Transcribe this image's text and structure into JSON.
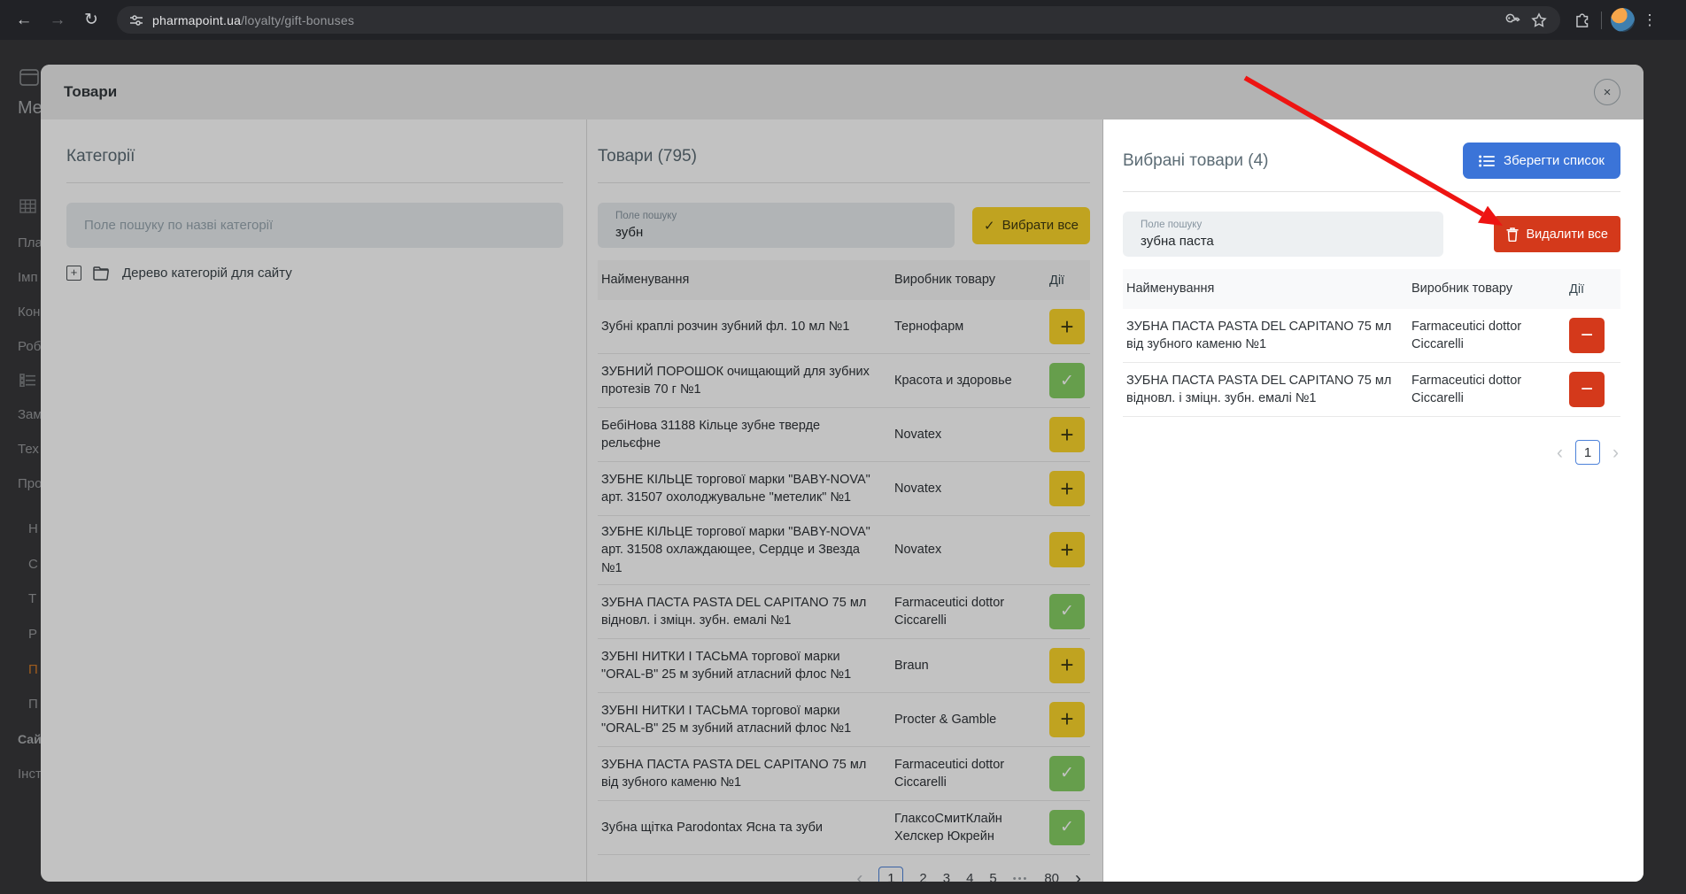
{
  "browser": {
    "url_domain": "pharmapoint.ua",
    "url_path": "/loyalty/gift-bonuses"
  },
  "sidebar": {
    "items": [
      {
        "label": "Me"
      },
      {
        "label": "Пла"
      },
      {
        "label": "Імп"
      },
      {
        "label": "Кон"
      },
      {
        "label": "Роб"
      },
      {
        "label": "Зам"
      },
      {
        "label": "Тех"
      },
      {
        "label": "Про"
      },
      {
        "label": "Н"
      },
      {
        "label": "С"
      },
      {
        "label": "Т"
      },
      {
        "label": "Р"
      },
      {
        "label": "П"
      },
      {
        "label": "П"
      },
      {
        "label": "Сай"
      },
      {
        "label": "Інст"
      }
    ]
  },
  "modal": {
    "title": "Товари"
  },
  "categories": {
    "title": "Категорії",
    "search_placeholder": "Поле пошуку по назві категорії",
    "tree_link": "Дерево категорій для сайту"
  },
  "products": {
    "title": "Товари (795)",
    "search_label": "Поле пошуку",
    "search_value": "зубн",
    "select_all_label": "Вибрати все",
    "columns": {
      "name": "Найменування",
      "manufacturer": "Виробник товару",
      "actions": "Дії"
    },
    "rows": [
      {
        "name": "Зубні краплі розчин зубний фл. 10 мл №1",
        "manufacturer": "Тернофарм",
        "state": "available"
      },
      {
        "name": "ЗУБНИЙ ПОРОШОК очищающий для зубних протезів 70 г №1",
        "manufacturer": "Красота и здоровье",
        "state": "added"
      },
      {
        "name": "БебіНова 31188 Кільце зубне тверде рельєфне",
        "manufacturer": "Novatex",
        "state": "available"
      },
      {
        "name": "ЗУБНЕ КІЛЬЦЕ торгової марки \"BABY-NOVA\" арт. 31507 охолоджувальне \"метелик\" №1",
        "manufacturer": "Novatex",
        "state": "available"
      },
      {
        "name": "ЗУБНЕ КІЛЬЦЕ торгової марки \"BABY-NOVA\" арт. 31508 охлаждающее, Сердце и Звезда №1",
        "manufacturer": "Novatex",
        "state": "available"
      },
      {
        "name": "ЗУБНА ПАСТА PASTA DEL CAPITANO 75 мл відновл. і зміцн. зубн. емалі №1",
        "manufacturer": "Farmaceutici dottor Ciccarelli",
        "state": "added"
      },
      {
        "name": "ЗУБНІ НИТКИ І ТАСЬМА торгової марки \"ORAL-B\" 25 м зубний атласний флос №1",
        "manufacturer": "Braun",
        "state": "available"
      },
      {
        "name": "ЗУБНІ НИТКИ І ТАСЬМА торгової марки \"ORAL-B\" 25 м зубний атласний флос №1",
        "manufacturer": "Procter & Gamble",
        "state": "available"
      },
      {
        "name": "ЗУБНА ПАСТА PASTA DEL CAPITANO 75 мл від зубного каменю №1",
        "manufacturer": "Farmaceutici dottor Ciccarelli",
        "state": "added"
      },
      {
        "name": "Зубна щітка Parodontax Ясна та зуби",
        "manufacturer": "ГлаксоСмитКлайн Хелскер Юкрейн",
        "state": "added"
      }
    ],
    "pagination": {
      "pages": [
        "1",
        "2",
        "3",
        "4",
        "5",
        "•••",
        "80"
      ],
      "active": "1"
    }
  },
  "selected": {
    "title": "Вибрані товари (4)",
    "save_list_label": "Зберегти список",
    "search_label": "Поле пошуку",
    "search_value": "зубна паста",
    "delete_all_label": "Видалити все",
    "columns": {
      "name": "Найменування",
      "manufacturer": "Виробник товару",
      "actions": "Дії"
    },
    "rows": [
      {
        "name": "ЗУБНА ПАСТА PASTA DEL CAPITANO 75 мл від зубного каменю №1",
        "manufacturer": "Farmaceutici dottor Ciccarelli"
      },
      {
        "name": "ЗУБНА ПАСТА PASTA DEL CAPITANO 75 мл відновл. і зміцн. зубн. емалі №1",
        "manufacturer": "Farmaceutici dottor Ciccarelli"
      }
    ],
    "pagination": {
      "active": "1"
    }
  },
  "icons": {
    "plus": "+",
    "check": "✓",
    "minus": "−",
    "close": "×",
    "chevron_left": "‹",
    "chevron_right": "›",
    "back": "←",
    "forward": "→",
    "reload": "↻",
    "kebab": "⋮"
  },
  "colors": {
    "accent_blue": "#3b74d8",
    "accent_yellow": "#fdd72b",
    "accent_green": "#87d065",
    "accent_red": "#d4391b",
    "arrow_red": "#ee1412"
  }
}
